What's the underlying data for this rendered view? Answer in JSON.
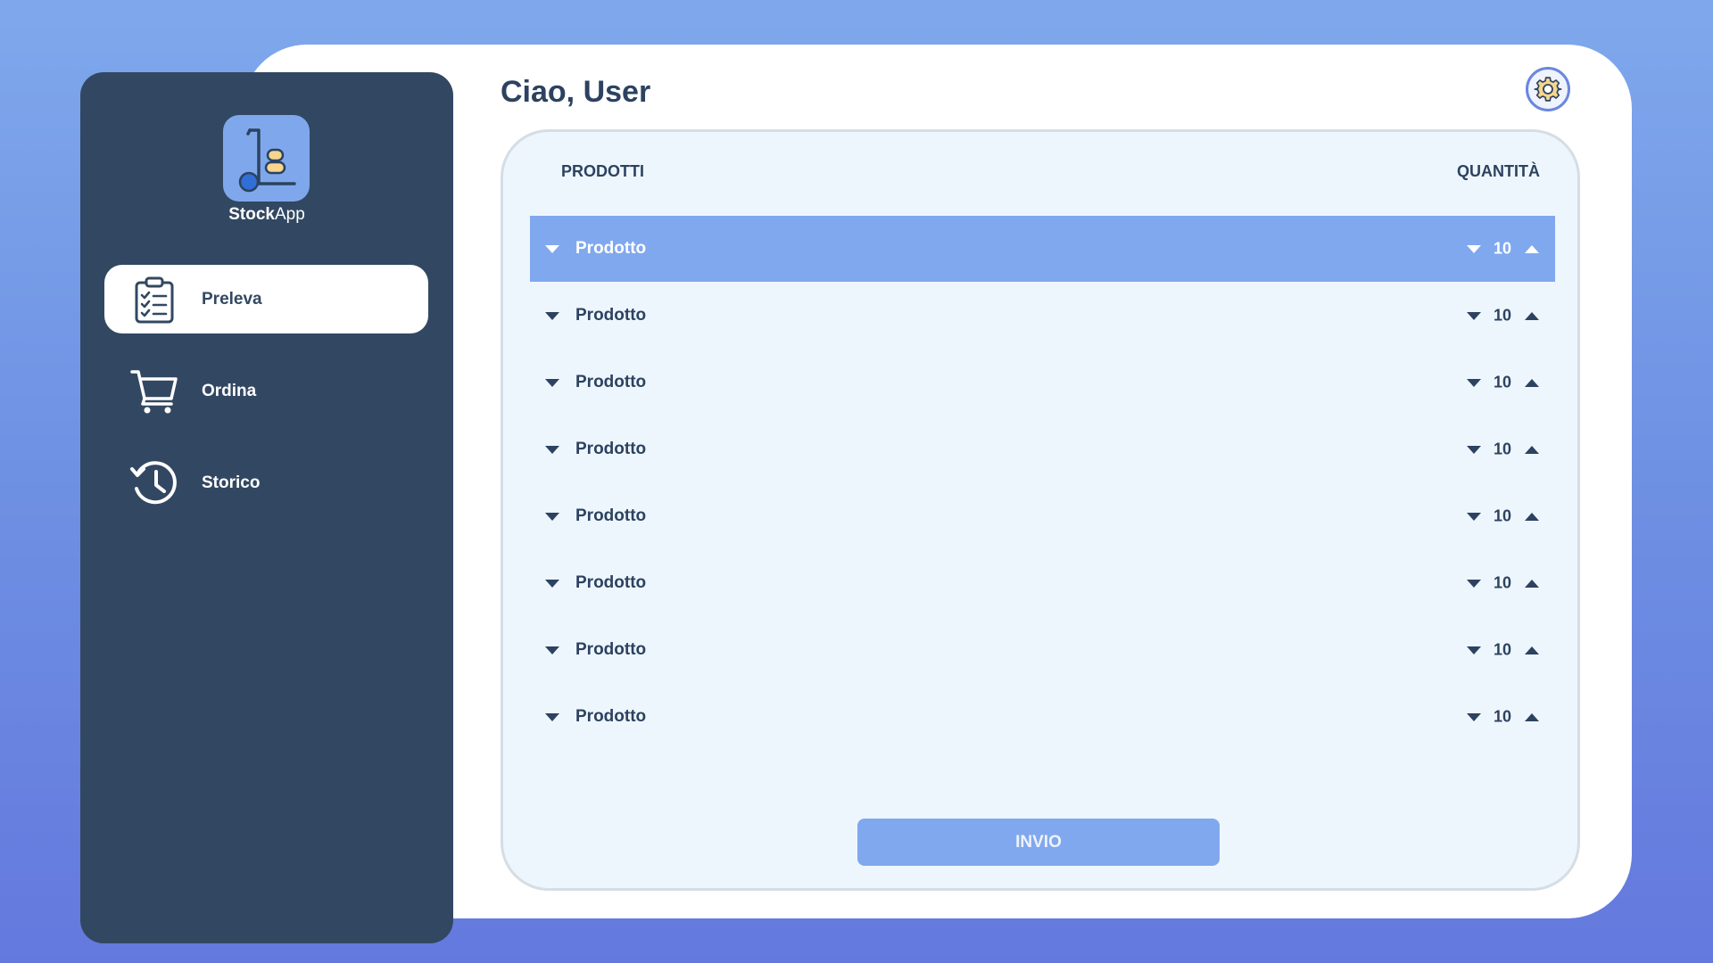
{
  "app": {
    "name_bold": "Stock",
    "name_light": "App"
  },
  "header": {
    "greeting": "Ciao, User"
  },
  "sidebar": {
    "items": [
      {
        "label": "Preleva",
        "icon": "clipboard-checklist-icon",
        "active": true
      },
      {
        "label": "Ordina",
        "icon": "shopping-cart-icon",
        "active": false
      },
      {
        "label": "Storico",
        "icon": "history-clock-icon",
        "active": false
      }
    ]
  },
  "table": {
    "columns": {
      "product": "PRODOTTI",
      "quantity": "QUANTITÀ"
    },
    "rows": [
      {
        "name": "Prodotto",
        "qty": "10",
        "selected": true
      },
      {
        "name": "Prodotto",
        "qty": "10",
        "selected": false
      },
      {
        "name": "Prodotto",
        "qty": "10",
        "selected": false
      },
      {
        "name": "Prodotto",
        "qty": "10",
        "selected": false
      },
      {
        "name": "Prodotto",
        "qty": "10",
        "selected": false
      },
      {
        "name": "Prodotto",
        "qty": "10",
        "selected": false
      },
      {
        "name": "Prodotto",
        "qty": "10",
        "selected": false
      },
      {
        "name": "Prodotto",
        "qty": "10",
        "selected": false
      }
    ]
  },
  "actions": {
    "submit_label": "INVIO"
  },
  "colors": {
    "sidebar": "#324862",
    "accent": "#80a8ee",
    "text_dark": "#2c4260",
    "panel": "#eef6fd"
  }
}
